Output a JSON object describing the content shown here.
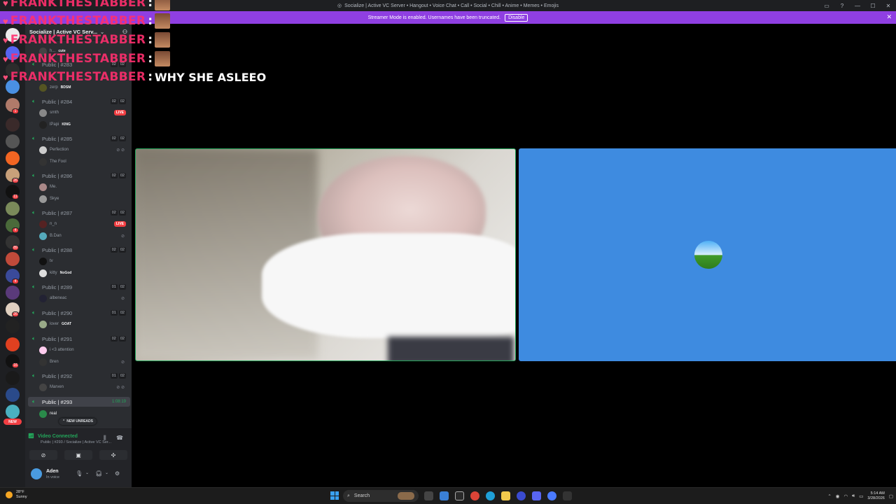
{
  "window": {
    "title": "Socialize | Active VC Server • Hangout • Voice Chat • Call • Social • Chill • Anime • Memes • Emojis"
  },
  "banner": {
    "text": "Streamer Mode is enabled. Usernames have been truncated.",
    "disable_label": "Disable"
  },
  "server": {
    "name": "Socialize | Active VC Serv..."
  },
  "rail": {
    "badges": [
      "1",
      "26",
      "11",
      "4",
      "89",
      "4",
      "26",
      "16"
    ],
    "new_label": "NEW"
  },
  "channels": [
    {
      "name": "Public | #283",
      "counts": [
        "02",
        "02"
      ],
      "users": [
        {
          "name": "zerp",
          "tag": "BDSM"
        }
      ]
    },
    {
      "name": "Public | #284",
      "counts": [
        "02",
        "02"
      ],
      "users": [
        {
          "name": "smth",
          "live": "LIVE"
        },
        {
          "name": "lPapi",
          "tag": "KING"
        }
      ]
    },
    {
      "name": "Public | #285",
      "counts": [
        "02",
        "02"
      ],
      "users": [
        {
          "name": "Perfection"
        },
        {
          "name": "The Fool"
        }
      ]
    },
    {
      "name": "Public | #286",
      "counts": [
        "02",
        "02"
      ],
      "users": [
        {
          "name": "Me."
        },
        {
          "name": "Skye"
        }
      ]
    },
    {
      "name": "Public | #287",
      "counts": [
        "02",
        "02"
      ],
      "users": [
        {
          "name": "n_n",
          "live": "LIVE"
        },
        {
          "name": "B.Dan"
        }
      ]
    },
    {
      "name": "Public | #288",
      "counts": [
        "02",
        "02"
      ],
      "users": [
        {
          "name": "tv"
        },
        {
          "name": "kitty",
          "tag": "NoGod"
        }
      ]
    },
    {
      "name": "Public | #289",
      "counts": [
        "01",
        "02"
      ],
      "users": [
        {
          "name": "albeneac"
        }
      ]
    },
    {
      "name": "Public | #290",
      "counts": [
        "01",
        "02"
      ],
      "users": [
        {
          "name": "lover",
          "tag": "GOAT"
        }
      ]
    },
    {
      "name": "Public | #291",
      "counts": [
        "02",
        "02"
      ],
      "users": [
        {
          "name": "i <3 attention"
        },
        {
          "name": "Bren"
        }
      ]
    },
    {
      "name": "Public | #292",
      "counts": [
        "01",
        "02"
      ],
      "users": [
        {
          "name": "Marven"
        }
      ]
    },
    {
      "name": "Public | #293",
      "timer": "1:08:19",
      "users": [
        {
          "name": "real"
        }
      ]
    }
  ],
  "first_user": {
    "name": "h...",
    "tag": "cute"
  },
  "new_unreads": "NEW UNREADS",
  "voice": {
    "status": "Video Connected",
    "sub": "Public | #293 / Socialize | Active VC Ser..."
  },
  "user_panel": {
    "name": "Aden",
    "status": "In voice"
  },
  "chat_overlay": {
    "username": "FRANKTHESTABBER",
    "colon": ":",
    "message": "WHY SHE ASLEEO"
  },
  "taskbar": {
    "temp": "28°F",
    "weather": "Sunny",
    "search": "Search",
    "time": "5:14 AM",
    "date": "3/28/2026"
  },
  "colors": {
    "accent_green": "#23a55a",
    "banner_purple": "#8f3fe2",
    "avatar_blue": "#3e8be0",
    "live_red": "#f23f43"
  }
}
